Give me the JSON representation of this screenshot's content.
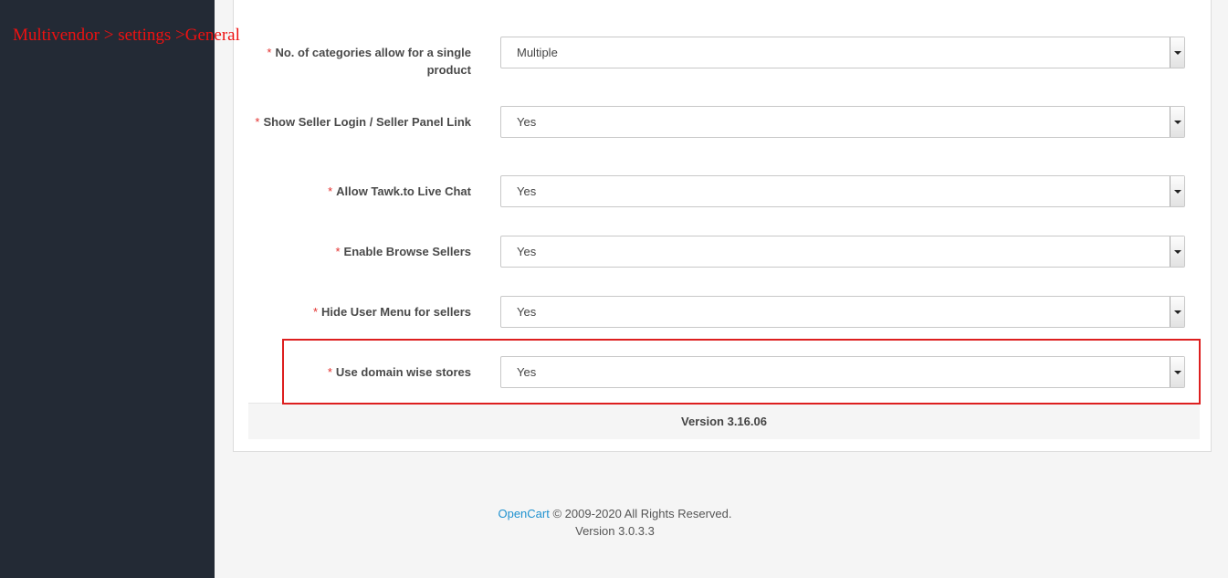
{
  "annotation": "Multivendor > settings >General",
  "required_mark": "*",
  "fields": [
    {
      "label": "No. of categories allow for a single product",
      "value": "Multiple"
    },
    {
      "label": "Show Seller Login / Seller Panel Link",
      "value": "Yes"
    },
    {
      "label": "Allow Tawk.to Live Chat",
      "value": "Yes"
    },
    {
      "label": "Enable Browse Sellers",
      "value": "Yes"
    },
    {
      "label": "Hide User Menu for sellers",
      "value": "Yes"
    },
    {
      "label": "Use domain wise stores",
      "value": "Yes"
    }
  ],
  "module_version": "Version 3.16.06",
  "footer": {
    "link": "OpenCart",
    "copyright": " © 2009-2020 All Rights Reserved.",
    "version": "Version 3.0.3.3"
  },
  "colors": {
    "sidebar": "#232a35",
    "annotation": "#ee1111",
    "highlight_border": "#dd1f1f",
    "required": "#e3312f",
    "link": "#1e91cf"
  }
}
